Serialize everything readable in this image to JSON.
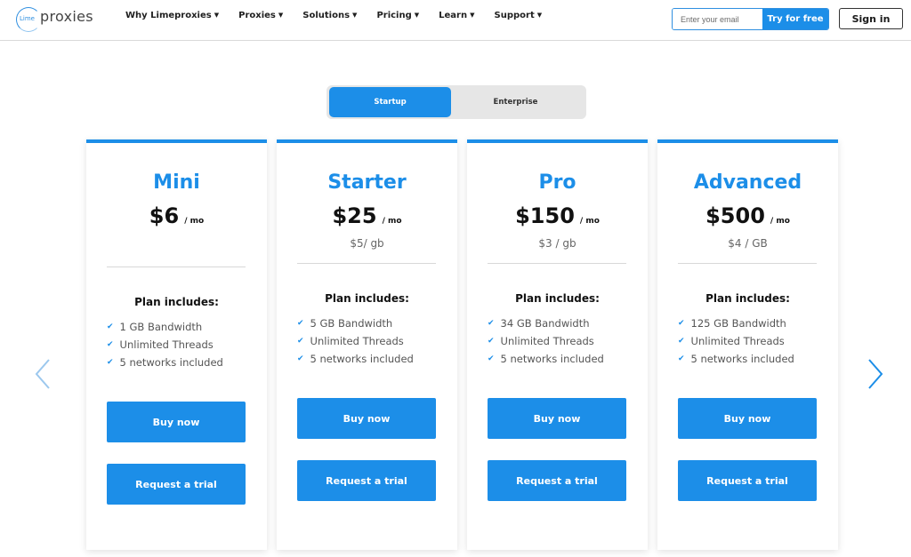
{
  "brand": {
    "logo_small": "Lime",
    "logo_main": "proxies"
  },
  "nav": [
    {
      "label": "Why Limeproxies"
    },
    {
      "label": "Proxies"
    },
    {
      "label": "Solutions"
    },
    {
      "label": "Pricing"
    },
    {
      "label": "Learn"
    },
    {
      "label": "Support"
    }
  ],
  "signup": {
    "email_placeholder": "Enter your email",
    "try_label": "Try for free",
    "signin_label": "Sign in"
  },
  "toggle": {
    "options": [
      "Startup",
      "Enterprise"
    ],
    "selected": "Startup"
  },
  "plans": [
    {
      "name": "Mini",
      "price": "$6",
      "unit": "/ mo",
      "rate": "",
      "includes_title": "Plan includes:",
      "features": [
        "1 GB Bandwidth",
        "Unlimited Threads",
        "5 networks included"
      ],
      "buy_label": "Buy now",
      "trial_label": "Request a trial"
    },
    {
      "name": "Starter",
      "price": "$25",
      "unit": "/ mo",
      "rate": "$5/ gb",
      "includes_title": "Plan includes:",
      "features": [
        "5 GB Bandwidth",
        "Unlimited Threads",
        "5 networks included"
      ],
      "buy_label": "Buy now",
      "trial_label": "Request a trial"
    },
    {
      "name": "Pro",
      "price": "$150",
      "unit": "/ mo",
      "rate": "$3 / gb",
      "includes_title": "Plan includes:",
      "features": [
        "34 GB Bandwidth",
        "Unlimited Threads",
        "5 networks included"
      ],
      "buy_label": "Buy now",
      "trial_label": "Request a trial"
    },
    {
      "name": "Advanced",
      "price": "$500",
      "unit": "/ mo",
      "rate": "$4 / GB",
      "includes_title": "Plan includes:",
      "features": [
        "125 GB Bandwidth",
        "Unlimited Threads",
        "5 networks included"
      ],
      "buy_label": "Buy now",
      "trial_label": "Request a trial"
    }
  ],
  "icons": {
    "check": "check-icon",
    "caret": "chevron-down-icon",
    "prev": "chevron-left-icon",
    "next": "chevron-right-icon"
  },
  "colors": {
    "accent": "#1c8ee8",
    "text": "#111111",
    "muted": "#666666"
  }
}
